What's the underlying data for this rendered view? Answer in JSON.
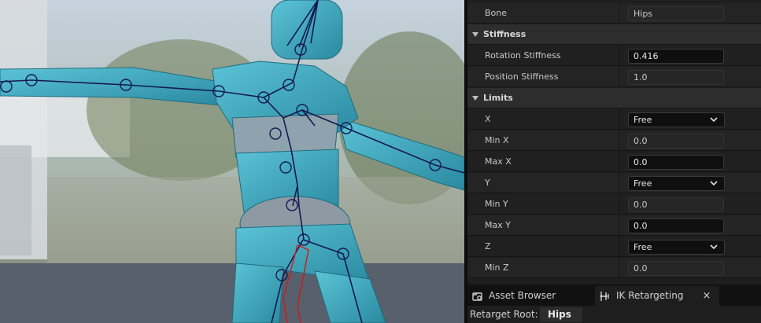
{
  "details": {
    "rows": [
      {
        "kind": "prop",
        "label": "Bone",
        "value": "Hips",
        "readonly": true
      },
      {
        "kind": "cat",
        "label": "Stiffness"
      },
      {
        "kind": "prop",
        "label": "Rotation Stiffness",
        "value": "0.416"
      },
      {
        "kind": "prop",
        "label": "Position Stiffness",
        "value": "1.0",
        "readonly": true
      },
      {
        "kind": "cat",
        "label": "Limits"
      },
      {
        "kind": "combo",
        "label": "X",
        "value": "Free"
      },
      {
        "kind": "prop",
        "label": "Min X",
        "value": "0.0",
        "readonly": true
      },
      {
        "kind": "prop",
        "label": "Max X",
        "value": "0.0"
      },
      {
        "kind": "combo",
        "label": "Y",
        "value": "Free"
      },
      {
        "kind": "prop",
        "label": "Min Y",
        "value": "0.0",
        "readonly": true
      },
      {
        "kind": "prop",
        "label": "Max Y",
        "value": "0.0"
      },
      {
        "kind": "combo",
        "label": "Z",
        "value": "Free"
      },
      {
        "kind": "prop",
        "label": "Min Z",
        "value": "0.0",
        "readonly": true
      }
    ]
  },
  "tabs": {
    "asset_browser": "Asset Browser",
    "ik_retargeting": "IK Retargeting",
    "close": "×"
  },
  "retarget": {
    "label": "Retarget Root:",
    "value": "Hips"
  },
  "colors": {
    "mannequin": "#3aa7bd",
    "bones": "#14194f",
    "highlight_bone": "#d11818",
    "panel_bg": "#1e1e1e"
  }
}
